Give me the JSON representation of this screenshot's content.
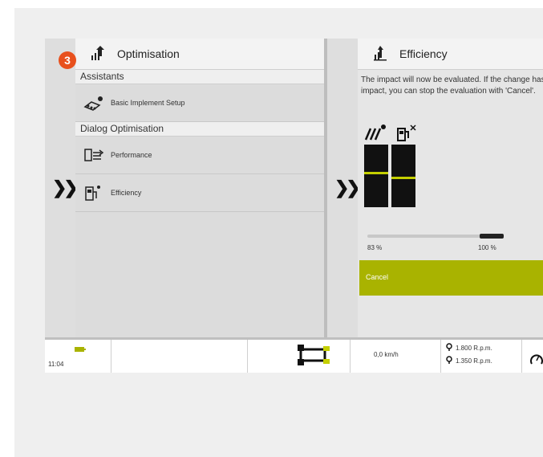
{
  "badge": "3",
  "left_panel": {
    "title": "Optimisation",
    "section1": "Assistants",
    "item1": "Basic Implement Setup",
    "section2": "Dialog Optimisation",
    "item2": "Performance",
    "item3": "Efficiency"
  },
  "right_panel": {
    "title": "Efficiency",
    "description": "The impact will now be evaluated. If the change has a bad impact, you can stop the evaluation with 'Cancel'.",
    "progress_left": "83 %",
    "progress_right": "100 %",
    "cancel": "Cancel"
  },
  "status": {
    "time": "11:04",
    "speed": "0,0 km/h",
    "rpm1": "1.800 R.p.m.",
    "rpm2": "1.350 R.p.m."
  },
  "colors": {
    "accent": "#a9b300",
    "badge": "#e8501d",
    "marker": "#c4cf00"
  },
  "icons": [
    "optimisation-icon",
    "implement-icon",
    "performance-icon",
    "fuel-icon",
    "efficiency-icon",
    "tractor-icon",
    "engine-icon",
    "chevron-right-icon"
  ]
}
